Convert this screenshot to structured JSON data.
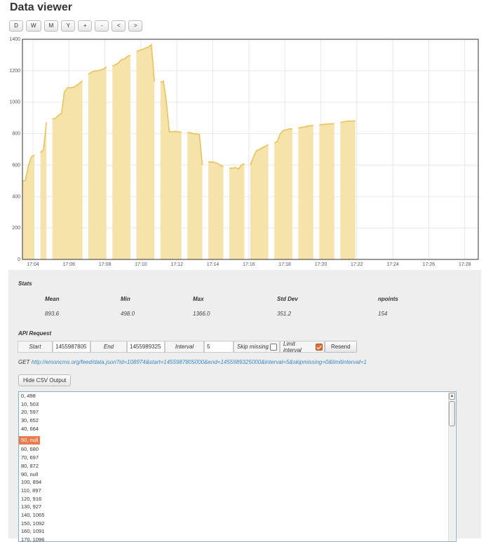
{
  "title": "Data viewer",
  "toolbar": {
    "buttons": [
      "D",
      "W",
      "M",
      "Y",
      "+",
      "-",
      "<",
      ">"
    ]
  },
  "chart_data": {
    "type": "area",
    "title": "",
    "xlabel": "",
    "ylabel": "",
    "ylim": [
      0,
      1400
    ],
    "xlim": [
      "17:03:25",
      "17:28:45"
    ],
    "y_ticks": [
      "0",
      "200",
      "400",
      "600",
      "800",
      "1000",
      "1200",
      "1400"
    ],
    "x_ticks": [
      "17:04",
      "17:06",
      "17:08",
      "17:10",
      "17:12",
      "17:14",
      "17:16",
      "17:18",
      "17:20",
      "17:22",
      "17:24",
      "17:26",
      "17:28"
    ],
    "grid": true,
    "color": "#e8c35a",
    "fill_color": "#f6e2ab",
    "interval_seconds": 5,
    "start_time": "17:03:25",
    "values": [
      498,
      503,
      597,
      652,
      664,
      null,
      680,
      697,
      872,
      null,
      894,
      897,
      916,
      927,
      1065,
      1092,
      1091,
      1096,
      1105,
      1120,
      1135,
      null,
      1180,
      1190,
      1198,
      1200,
      1205,
      1210,
      1225,
      null,
      1230,
      1238,
      1250,
      1270,
      1275,
      1290,
      1300,
      null,
      1320,
      1330,
      1335,
      1345,
      1350,
      1366,
      1130,
      null,
      1125,
      1135,
      1000,
      810,
      812,
      815,
      810,
      810,
      null,
      808,
      805,
      800,
      798,
      795,
      600,
      null,
      620,
      620,
      618,
      610,
      600,
      590,
      null,
      580,
      580,
      585,
      575,
      600,
      608,
      null,
      600,
      650,
      690,
      700,
      710,
      720,
      730,
      null,
      740,
      750,
      800,
      820,
      825,
      830,
      830,
      null,
      835,
      840,
      842,
      848,
      850,
      852,
      null,
      855,
      858,
      860,
      862,
      862,
      865,
      null,
      870,
      875,
      878,
      880,
      880,
      882
    ],
    "series": [
      {
        "name": "",
        "values": "see values"
      }
    ]
  },
  "stats": {
    "title": "Stats",
    "headers": [
      "Mean",
      "Min",
      "Max",
      "Std Dev",
      "npoints"
    ],
    "values": [
      "893.6",
      "498.0",
      "1366.0",
      "351.2",
      "154"
    ]
  },
  "api": {
    "title": "API Request",
    "start_label": "Start",
    "start_value": "1455987805",
    "end_label": "End",
    "end_value": "1455989325",
    "interval_label": "Interval",
    "interval_value": "5",
    "skip_missing_label": "Skip missing",
    "skip_missing_checked": false,
    "limit_interval_label": "Limit interval",
    "limit_interval_checked": true,
    "resend_label": "Resend",
    "get_prefix": "GET",
    "get_url": "http://emoncms.org/feed/data.json?id=108974&start=1455987805000&end=1455989325000&interval=5&skipmissing=0&limitinterval=1"
  },
  "csv": {
    "toggle_label": "Hide CSV Output",
    "lines": [
      "0, 498",
      "10, 503",
      "20, 597",
      "30, 652",
      "40, 664",
      "50, null",
      "60, 680",
      "70, 697",
      "80, 872",
      "90, null",
      "100, 894",
      "110, 897",
      "120, 916",
      "130, 927",
      "140, 1065",
      "150, 1092",
      "160, 1091",
      "170, 1096"
    ],
    "selected_index": 5
  }
}
